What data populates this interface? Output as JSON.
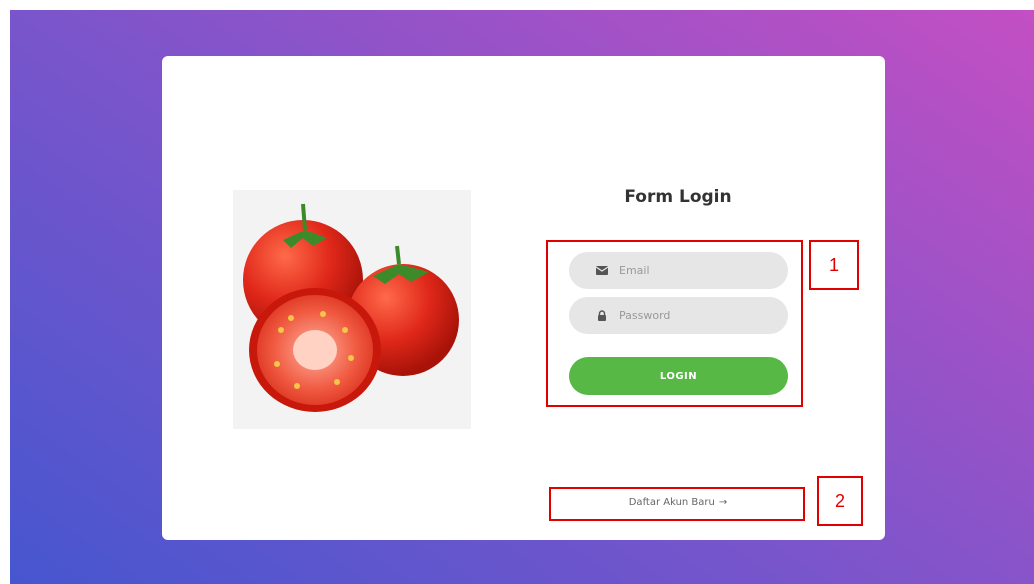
{
  "colors": {
    "gradient_start": "#4656cf",
    "gradient_end": "#c34fc3",
    "login_button": "#57b846",
    "input_bg": "#e6e6e6",
    "annotation": "#e00000"
  },
  "image": {
    "icon": "tomato-image"
  },
  "form": {
    "title": "Form Login",
    "email": {
      "placeholder": "Email",
      "icon": "envelope-icon"
    },
    "password": {
      "placeholder": "Password",
      "icon": "lock-icon"
    },
    "login_label": "LOGIN"
  },
  "signup": {
    "label": "Daftar Akun Baru",
    "arrow": "→"
  },
  "annotations": {
    "label_1": "1",
    "label_2": "2"
  }
}
